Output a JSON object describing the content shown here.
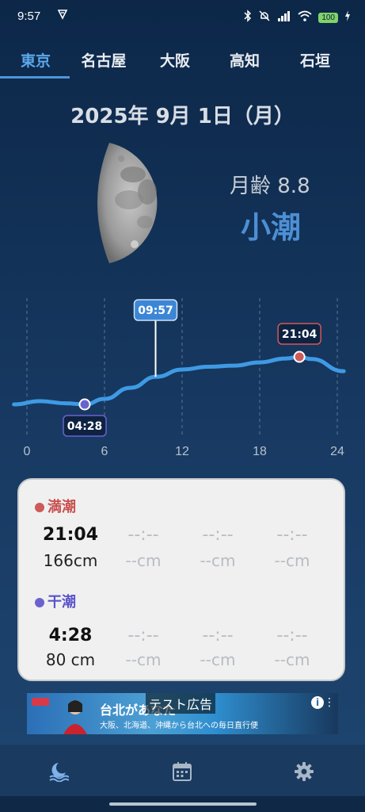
{
  "status_bar": {
    "time": "9:57",
    "battery": "100"
  },
  "tabs": [
    {
      "label": "東京",
      "active": true
    },
    {
      "label": "名古屋",
      "active": false
    },
    {
      "label": "大阪",
      "active": false
    },
    {
      "label": "高知",
      "active": false
    },
    {
      "label": "石垣",
      "active": false
    }
  ],
  "date": "2025年 9月 1日（月）",
  "moon": {
    "age_text": "月齢 8.8",
    "tide_type": "小潮"
  },
  "chart_data": {
    "type": "line",
    "x_ticks": [
      "0",
      "6",
      "12",
      "18",
      "24"
    ],
    "xlim": [
      0,
      24
    ],
    "grid": true,
    "series": [
      {
        "x": [
          -1,
          1,
          3,
          4.47,
          6,
          8,
          10,
          12,
          14,
          16,
          18,
          20,
          21.07,
          22,
          24.5
        ],
        "y": [
          80,
          86,
          82,
          80,
          90,
          110,
          130,
          143,
          148,
          150,
          156,
          163,
          166,
          162,
          140
        ]
      }
    ],
    "markers": [
      {
        "label": "04:28",
        "x": 4.47,
        "kind": "low"
      },
      {
        "label": "21:04",
        "x": 21.07,
        "kind": "high"
      }
    ],
    "current_time": {
      "label": "09:57",
      "x": 9.95
    },
    "colors": {
      "line": "#3f9ae4",
      "high": "#cf5a5a",
      "low": "#6a63cf"
    }
  },
  "tide_table": {
    "high": {
      "label": "満潮",
      "entries": [
        {
          "time": "21:04",
          "height": "166cm"
        },
        {
          "time": "--:--",
          "height": "--cm"
        },
        {
          "time": "--:--",
          "height": "--cm"
        },
        {
          "time": "--:--",
          "height": "--cm"
        }
      ]
    },
    "low": {
      "label": "干潮",
      "entries": [
        {
          "time": "4:28",
          "height": "80 cm"
        },
        {
          "time": "--:--",
          "height": "--cm"
        },
        {
          "time": "--:--",
          "height": "--cm"
        },
        {
          "time": "--:--",
          "height": "--cm"
        }
      ]
    }
  },
  "ad": {
    "label": "テスト広告",
    "headline": "台北があなた",
    "sub": "大阪、北海道、沖縄から台北への毎日直行便"
  },
  "bottom_nav": [
    {
      "icon": "moon-wave-icon",
      "active": true
    },
    {
      "icon": "calendar-icon",
      "active": false
    },
    {
      "icon": "gear-icon",
      "active": false
    }
  ]
}
